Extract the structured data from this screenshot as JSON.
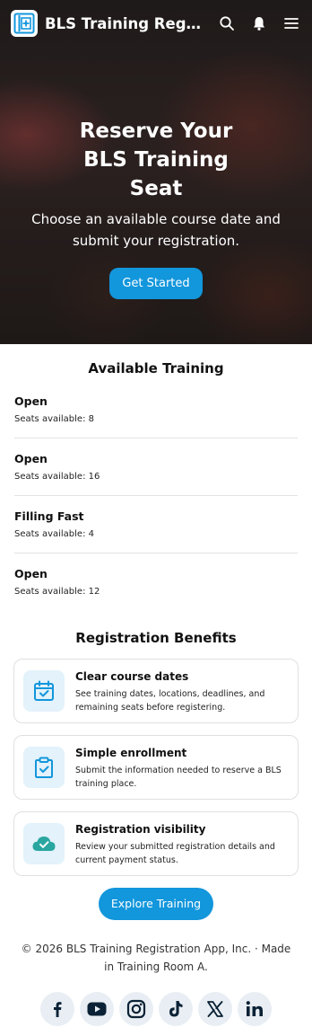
{
  "header": {
    "app_title": "BLS Training Registrati…",
    "icons": [
      "logo-icon",
      "search-icon",
      "notification-icon",
      "menu-icon"
    ]
  },
  "hero": {
    "title": "Reserve Your BLS Training Seat",
    "subtitle": "Choose an available course date and submit your registration.",
    "cta_label": "Get Started"
  },
  "available": {
    "title": "Available Training",
    "items": [
      {
        "status": "Open",
        "seats": "Seats available: 8"
      },
      {
        "status": "Open",
        "seats": "Seats available: 16"
      },
      {
        "status": "Filling Fast",
        "seats": "Seats available: 4"
      },
      {
        "status": "Open",
        "seats": "Seats available: 12"
      }
    ]
  },
  "benefits": {
    "title": "Registration Benefits",
    "cards": [
      {
        "icon": "calendar-check-icon",
        "title": "Clear course dates",
        "desc": "See training dates, locations, deadlines, and remaining seats before registering."
      },
      {
        "icon": "clipboard-check-icon",
        "title": "Simple enrollment",
        "desc": "Submit the information needed to reserve a BLS training place."
      },
      {
        "icon": "cloud-check-icon",
        "title": "Registration visibility",
        "desc": "Review your submitted registration details and current payment status."
      }
    ],
    "cta_label": "Explore Training"
  },
  "footer": {
    "copyright": "© 2026 BLS Training Registration App, Inc. · Made in Training Room A.",
    "socials": [
      "facebook-icon",
      "youtube-icon",
      "instagram-icon",
      "tiktok-icon",
      "x-icon",
      "linkedin-icon"
    ]
  },
  "colors": {
    "accent": "#1296dc",
    "icon_bg": "#e3f2fb",
    "icon_teal": "#2aa6a0",
    "social_bg": "#e8eef3"
  }
}
